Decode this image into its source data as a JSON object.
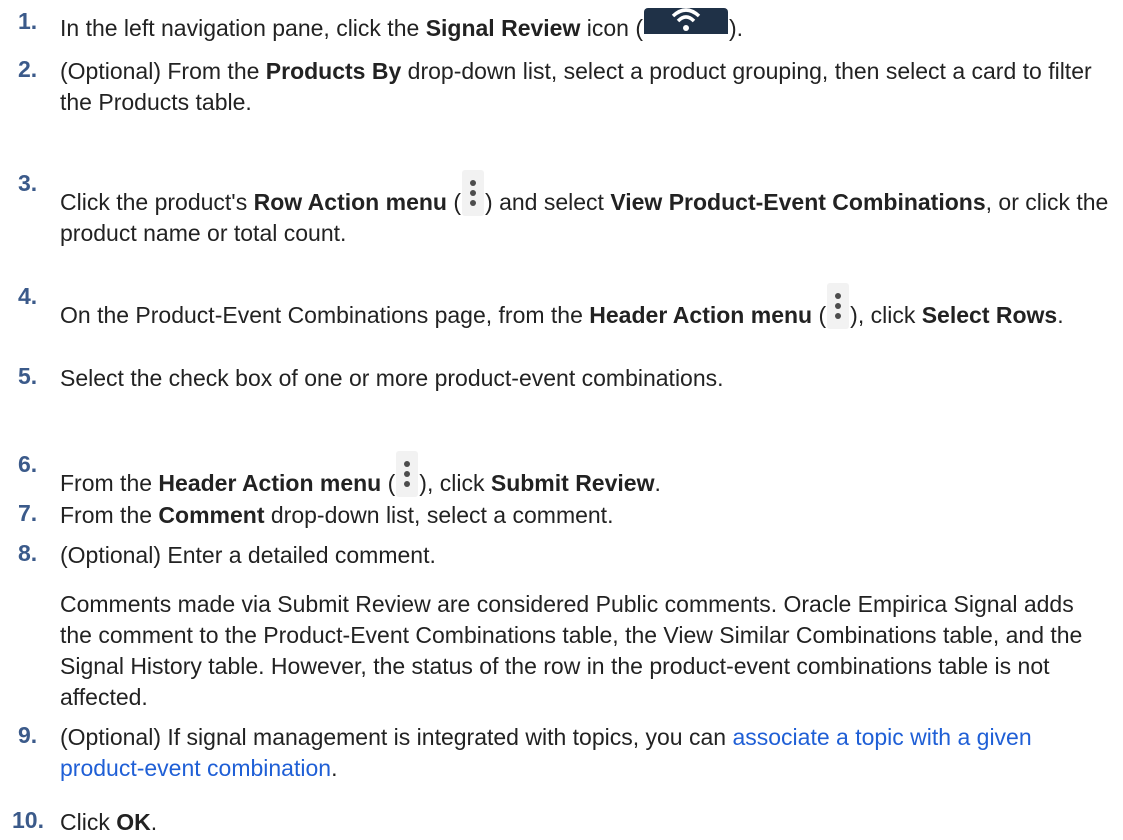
{
  "steps": [
    {
      "n": "1.",
      "a": "In the left navigation pane, click the ",
      "b": "Signal Review",
      "c": " icon (",
      "d": ")."
    },
    {
      "n": "2.",
      "a": "(Optional) From the ",
      "b": "Products By",
      "c": " drop-down list, select a product grouping, then select a card to filter the Products table."
    },
    {
      "n": "3.",
      "a": "Click the product's ",
      "b": "Row Action menu",
      "c": " (",
      "d": ") and select ",
      "e": "View Product-Event Combinations",
      "f": ", or click the product name or total count."
    },
    {
      "n": "4.",
      "a": "On the Product-Event Combinations page, from the ",
      "b": "Header Action menu",
      "c": " (",
      "d": "), click ",
      "e": "Select Rows",
      "f": "."
    },
    {
      "n": "5.",
      "a": "Select the check box of one or more product-event combinations."
    },
    {
      "n": "6.",
      "a": "From the ",
      "b": "Header Action menu",
      "c": " (",
      "d": "), click ",
      "e": "Submit Review",
      "f": "."
    },
    {
      "n": "7.",
      "a": "From the ",
      "b": "Comment",
      "c": " drop-down list, select a comment."
    },
    {
      "n": "8.",
      "a": "(Optional) Enter a detailed comment.",
      "para": "Comments made via Submit Review are considered Public comments. Oracle Empirica Signal adds the comment to the Product-Event Combinations table, the View Similar Combinations table, and the Signal History table. However, the status of the row in the product-event combinations table is not affected."
    },
    {
      "n": "9.",
      "a": "(Optional) If signal management is integrated with topics, you can ",
      "link": "associate a topic with a given product-event combination",
      "c": "."
    },
    {
      "n": "10.",
      "a": "Click ",
      "b": "OK",
      "c": "."
    }
  ],
  "colors": {
    "step_number": "#3b5a8a",
    "link": "#1f5fd6",
    "icon_bg": "#1f3147",
    "text": "#222222"
  }
}
